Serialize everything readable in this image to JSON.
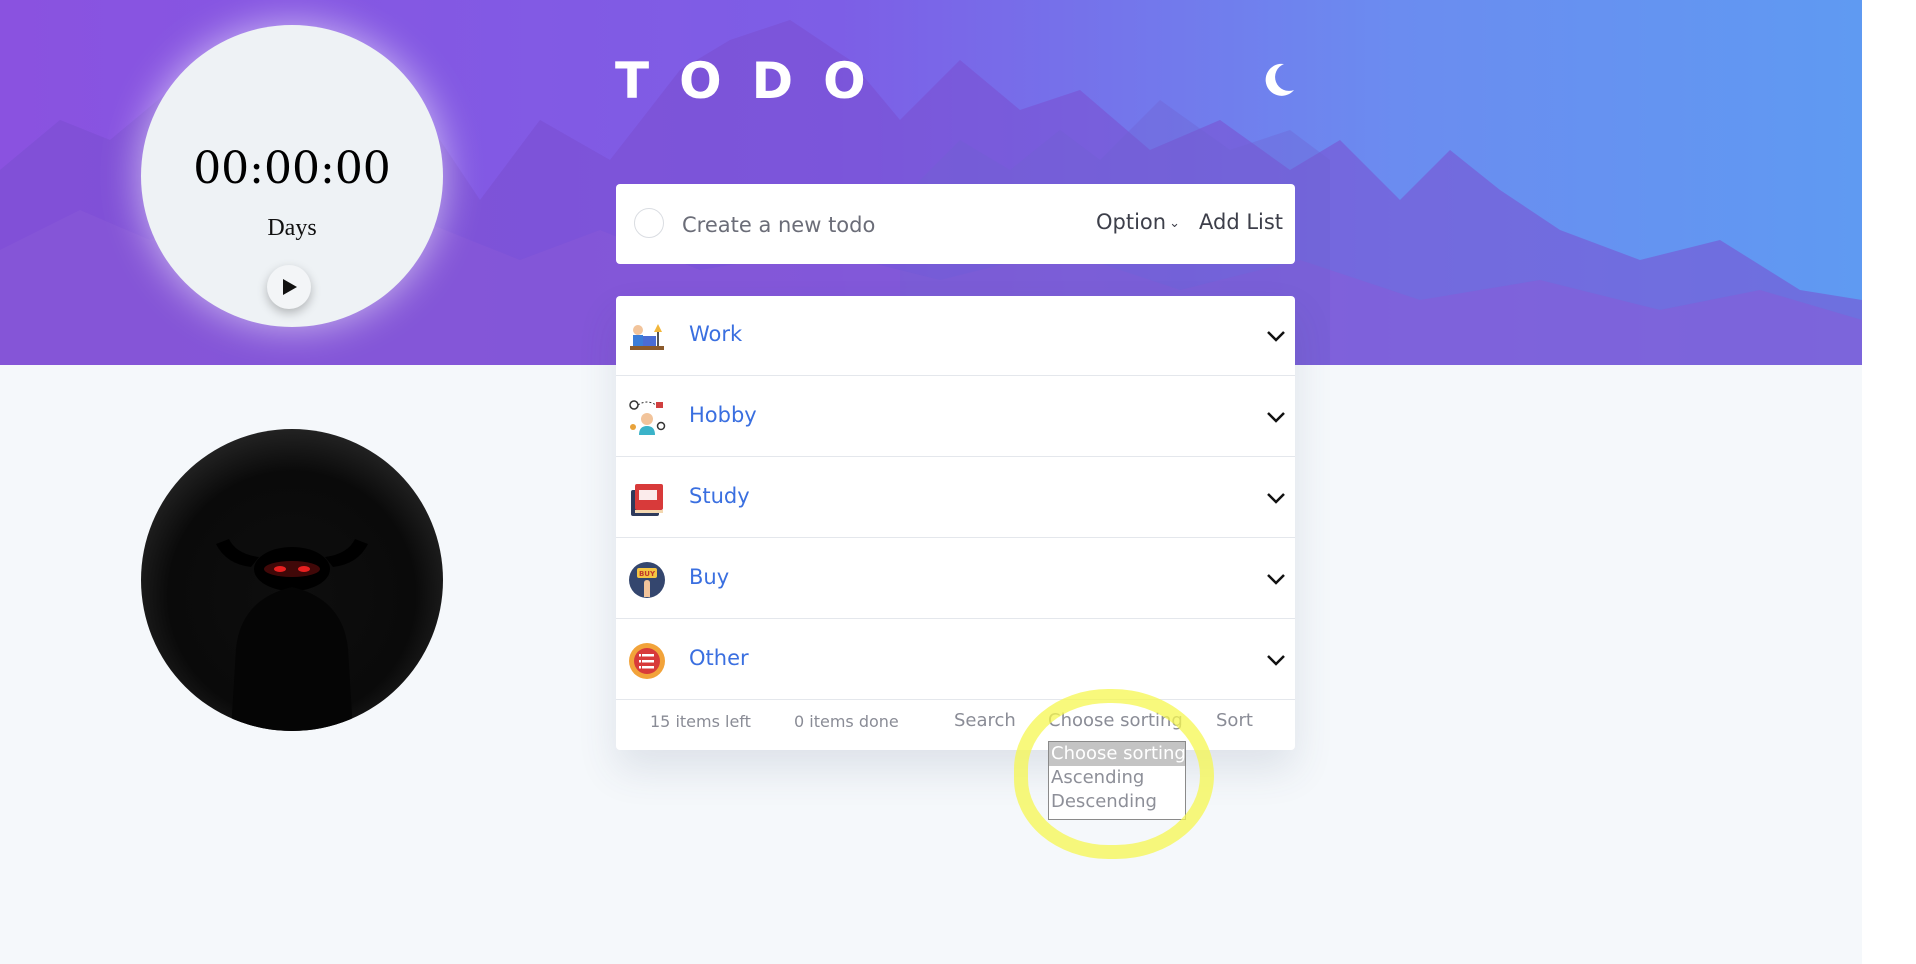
{
  "header": {
    "title": "TODO",
    "theme_toggle_icon": "moon-icon"
  },
  "timer": {
    "time": "00:00:00",
    "label": "Days",
    "play_icon": "play-icon"
  },
  "avatar": {
    "description_icon": "avatar-image"
  },
  "create": {
    "placeholder": "Create a new todo",
    "option_label": "Option",
    "add_list_label": "Add List"
  },
  "categories": [
    {
      "label": "Work",
      "icon": "work-icon"
    },
    {
      "label": "Hobby",
      "icon": "hobby-icon"
    },
    {
      "label": "Study",
      "icon": "study-icon"
    },
    {
      "label": "Buy",
      "icon": "buy-icon",
      "badge": "BUY"
    },
    {
      "label": "Other",
      "icon": "other-icon"
    }
  ],
  "footer": {
    "items_left": "15 items left",
    "items_done": "0 items done",
    "search_label": "Search",
    "sort_select_value": "Choose sorting",
    "sort_label": "Sort"
  },
  "sort_options": [
    "Choose sorting",
    "Ascending",
    "Descending"
  ],
  "colors": {
    "accent": "#3a6fe0",
    "highlight": "#f6f750",
    "hero_start": "#8a52e0",
    "hero_end": "#5f9af2"
  }
}
